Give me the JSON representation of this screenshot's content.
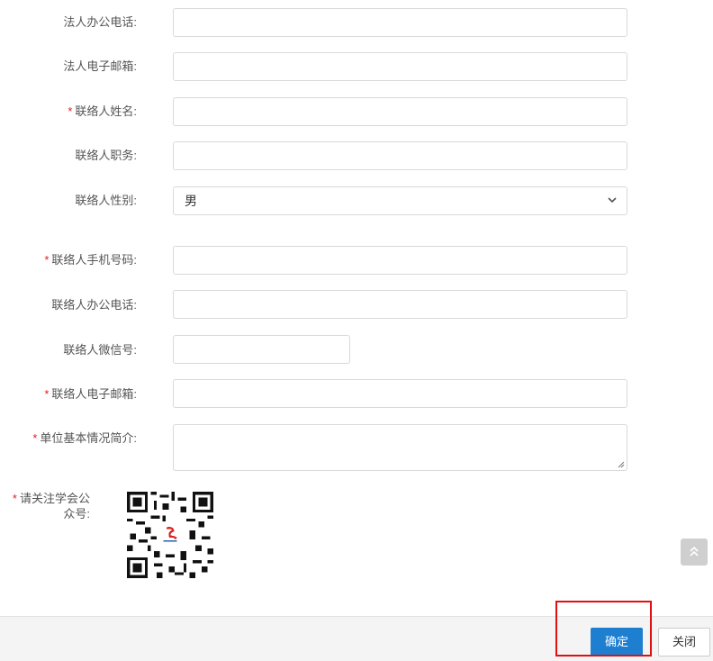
{
  "form": {
    "legal_office_phone": {
      "label": "法人办公电话:",
      "value": ""
    },
    "legal_email": {
      "label": "法人电子邮箱:",
      "value": ""
    },
    "contact_name": {
      "label": "联络人姓名:",
      "required": "*",
      "value": ""
    },
    "contact_title": {
      "label": "联络人职务:",
      "value": ""
    },
    "contact_gender": {
      "label": "联络人性别:",
      "value": "男"
    },
    "contact_mobile": {
      "label": "联络人手机号码:",
      "required": "*",
      "value": ""
    },
    "contact_office_phone": {
      "label": "联络人办公电话:",
      "value": ""
    },
    "contact_wechat": {
      "label": "联络人微信号:",
      "value": ""
    },
    "contact_email": {
      "label": "联络人电子邮箱:",
      "required": "*",
      "value": ""
    },
    "org_intro": {
      "label": "单位基本情况简介:",
      "required": "*",
      "value": ""
    },
    "follow_account": {
      "required": "*",
      "label_line1": "请关注学会公",
      "label_line2": "众号:"
    }
  },
  "footer": {
    "confirm_label": "确定",
    "close_label": "关闭"
  },
  "colors": {
    "primary": "#1e7fd1",
    "required": "#e02020",
    "highlight": "#e01010"
  },
  "icons": {
    "select_arrow": "chevron-down-icon",
    "scroll_top": "double-chevron-up-icon",
    "qr": "qr-code"
  }
}
